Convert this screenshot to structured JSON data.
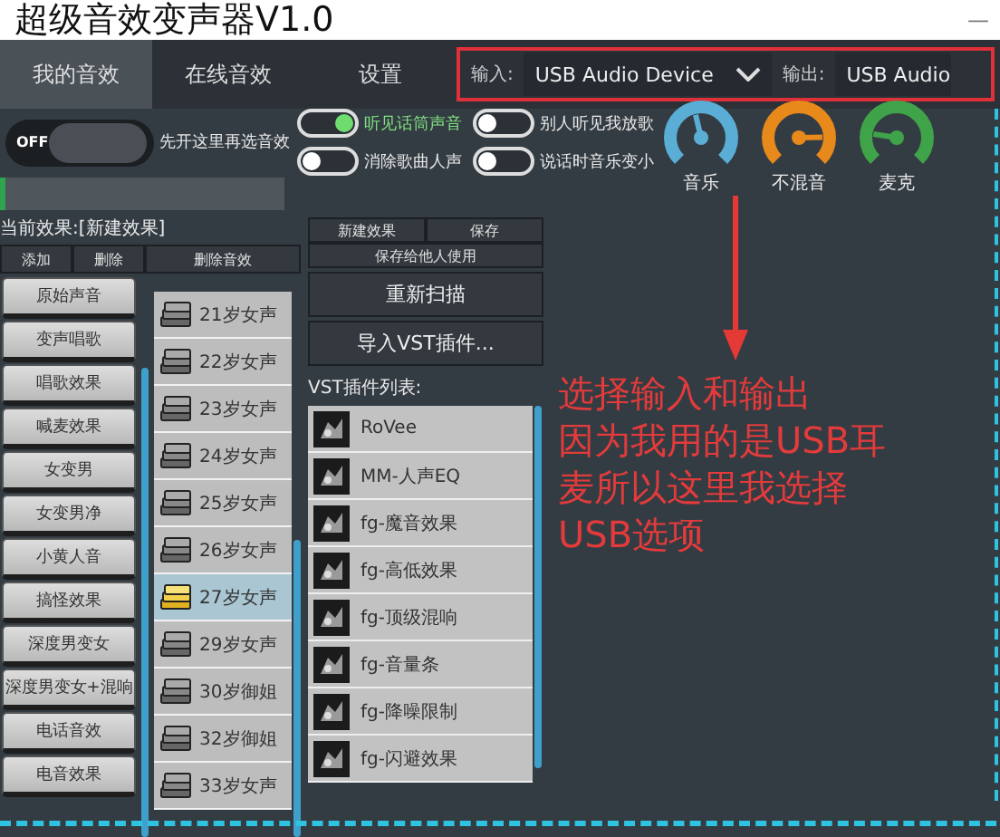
{
  "window": {
    "title": "超级音效变声器V1.0",
    "minimize": "—"
  },
  "tabs": [
    {
      "label": "我的音效",
      "selected": true
    },
    {
      "label": "在线音效",
      "selected": false
    },
    {
      "label": "设置",
      "selected": false
    }
  ],
  "io": {
    "input_label": "输入:",
    "input_value": "USB Audio Device",
    "output_label": "输出:",
    "output_value": "USB Audio"
  },
  "power": {
    "label": "OFF",
    "on": false,
    "hint": "先开这里再选音效"
  },
  "toggles": [
    {
      "label": "听见话筒声音",
      "on": true
    },
    {
      "label": "消除歌曲人声",
      "on": false
    },
    {
      "label": "别人听见我放歌",
      "on": false
    },
    {
      "label": "说话时音乐变小",
      "on": false
    }
  ],
  "knobs": [
    {
      "label": "音乐",
      "level": 0.45,
      "color": "#5aaed6"
    },
    {
      "label": "不混音",
      "level": 0.83,
      "color": "#e8891c"
    },
    {
      "label": "麦克",
      "level": 0.2,
      "color": "#3fa34a"
    }
  ],
  "current_effect": "当前效果:[新建效果]",
  "effect_buttons": [
    "添加",
    "删除",
    "删除音效"
  ],
  "categories": [
    "原始声音",
    "变声唱歌",
    "唱歌效果",
    "喊麦效果",
    "女变男",
    "女变男净",
    "小黄人音",
    "搞怪效果",
    "深度男变女",
    "深度男变女+混响",
    "电话音效",
    "电音效果"
  ],
  "presets": [
    {
      "label": "21岁女声",
      "selected": false
    },
    {
      "label": "22岁女声",
      "selected": false
    },
    {
      "label": "23岁女声",
      "selected": false
    },
    {
      "label": "24岁女声",
      "selected": false
    },
    {
      "label": "25岁女声",
      "selected": false
    },
    {
      "label": "26岁女声",
      "selected": false
    },
    {
      "label": "27岁女声",
      "selected": true
    },
    {
      "label": "29岁女声",
      "selected": false
    },
    {
      "label": "30岁御姐",
      "selected": false
    },
    {
      "label": "32岁御姐",
      "selected": false
    },
    {
      "label": "33岁女声",
      "selected": false
    }
  ],
  "top_actions": [
    "新建效果",
    "保存"
  ],
  "share_action": "保存给他人使用",
  "big_actions": [
    "重新扫描",
    "导入VST插件..."
  ],
  "vst_label": "VST插件列表:",
  "plugins": [
    "RoVee",
    "MM-人声EQ",
    "fg-魔音效果",
    "fg-高低效果",
    "fg-顶级混响",
    "fg-音量条",
    "fg-降噪限制",
    "fg-闪避效果"
  ],
  "annotation": [
    "选择输入和输出",
    "因为我用的是USB耳",
    "麦所以这里我选择",
    "USB选项"
  ]
}
